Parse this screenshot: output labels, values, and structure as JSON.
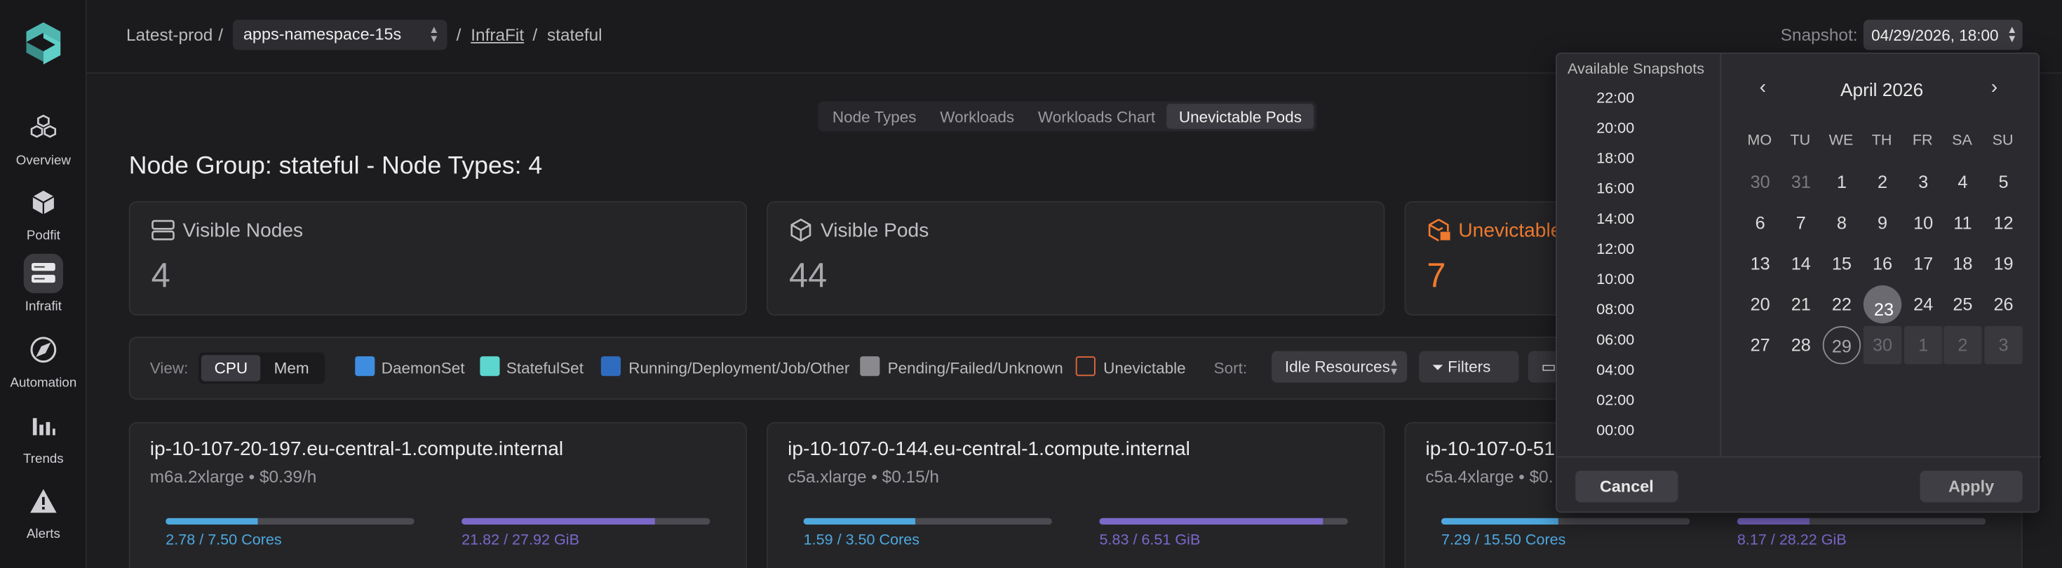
{
  "sidebar": {
    "items": [
      {
        "label": "Overview",
        "icon": "cubes-icon"
      },
      {
        "label": "Podfit",
        "icon": "cube-icon"
      },
      {
        "label": "Infrafit",
        "icon": "server-icon"
      },
      {
        "label": "Automation",
        "icon": "compass-icon"
      },
      {
        "label": "Trends",
        "icon": "bar-chart-icon"
      },
      {
        "label": "Alerts",
        "icon": "alert-icon"
      }
    ],
    "active": "Infrafit"
  },
  "breadcrumb": {
    "root": "Latest-prod",
    "sep": "/",
    "namespace": "apps-namespace-15s",
    "section": "InfraFit",
    "current": "stateful"
  },
  "snapshot": {
    "label": "Snapshot:",
    "value": "04/29/2026, 18:00"
  },
  "tabs": [
    "Node Types",
    "Workloads",
    "Workloads Chart",
    "Unevictable Pods"
  ],
  "active_tab": "Unevictable Pods",
  "page_title": "Node Group: stateful - Node Types: 4",
  "summary": [
    {
      "label": "Visible Nodes",
      "value": "4"
    },
    {
      "label": "Visible Pods",
      "value": "44"
    },
    {
      "label": "Unevictable",
      "value": "7"
    }
  ],
  "filters": {
    "view_label": "View:",
    "view_options": [
      "CPU",
      "Mem"
    ],
    "view_active": "CPU",
    "legend": [
      {
        "label": "DaemonSet",
        "color": "#3f8de0"
      },
      {
        "label": "StatefulSet",
        "color": "#5cd6cf"
      },
      {
        "label": "Running/Deployment/Job/Other",
        "color": "#2f6cbf"
      },
      {
        "label": "Pending/Failed/Unknown",
        "color": "#8a8a8e"
      },
      {
        "label": "Unevictable",
        "color": "#e0673a"
      }
    ],
    "sort_label": "Sort:",
    "sort_value": "Idle Resources",
    "filters_button": "Filters"
  },
  "nodes": [
    {
      "name": "ip-10-107-20-197.eu-central-1.compute.internal",
      "type": "m6a.2xlarge • $0.39/h",
      "cpu": "2.78 / 7.50 Cores",
      "cpu_fill": 0.37,
      "mem": "21.82 / 27.92 GiB",
      "mem_fill": 0.78
    },
    {
      "name": "ip-10-107-0-144.eu-central-1.compute.internal",
      "type": "c5a.xlarge • $0.15/h",
      "cpu": "1.59 / 3.50 Cores",
      "cpu_fill": 0.45,
      "mem": "5.83 / 6.51 GiB",
      "mem_fill": 0.9
    },
    {
      "name": "ip-10-107-0-51",
      "type": "c5a.4xlarge • $0.",
      "cpu": "7.29 / 15.50 Cores",
      "cpu_fill": 0.47,
      "mem": "8.17 / 28.22 GiB",
      "mem_fill": 0.29
    }
  ],
  "picker": {
    "times_header": "Available Snapshots",
    "times": [
      "22:00",
      "20:00",
      "18:00",
      "16:00",
      "14:00",
      "12:00",
      "10:00",
      "08:00",
      "06:00",
      "04:00",
      "02:00",
      "00:00"
    ],
    "month": "April 2026",
    "weekdays": [
      "MO",
      "TU",
      "WE",
      "TH",
      "FR",
      "SA",
      "SU"
    ],
    "weeks": [
      [
        "30",
        "31",
        "1",
        "2",
        "3",
        "4",
        "5"
      ],
      [
        "6",
        "7",
        "8",
        "9",
        "10",
        "11",
        "12"
      ],
      [
        "13",
        "14",
        "15",
        "16",
        "17",
        "18",
        "19"
      ],
      [
        "20",
        "21",
        "22",
        "23",
        "24",
        "25",
        "26"
      ],
      [
        "27",
        "28",
        "29",
        "30",
        "1",
        "2",
        "3"
      ]
    ],
    "selected": "23",
    "today": "29",
    "cancel": "Cancel",
    "apply": "Apply"
  },
  "colors": {
    "accent_orange": "#f07a2e",
    "cpu_blue": "#4ea8de",
    "mem_purple": "#7b68c9"
  }
}
